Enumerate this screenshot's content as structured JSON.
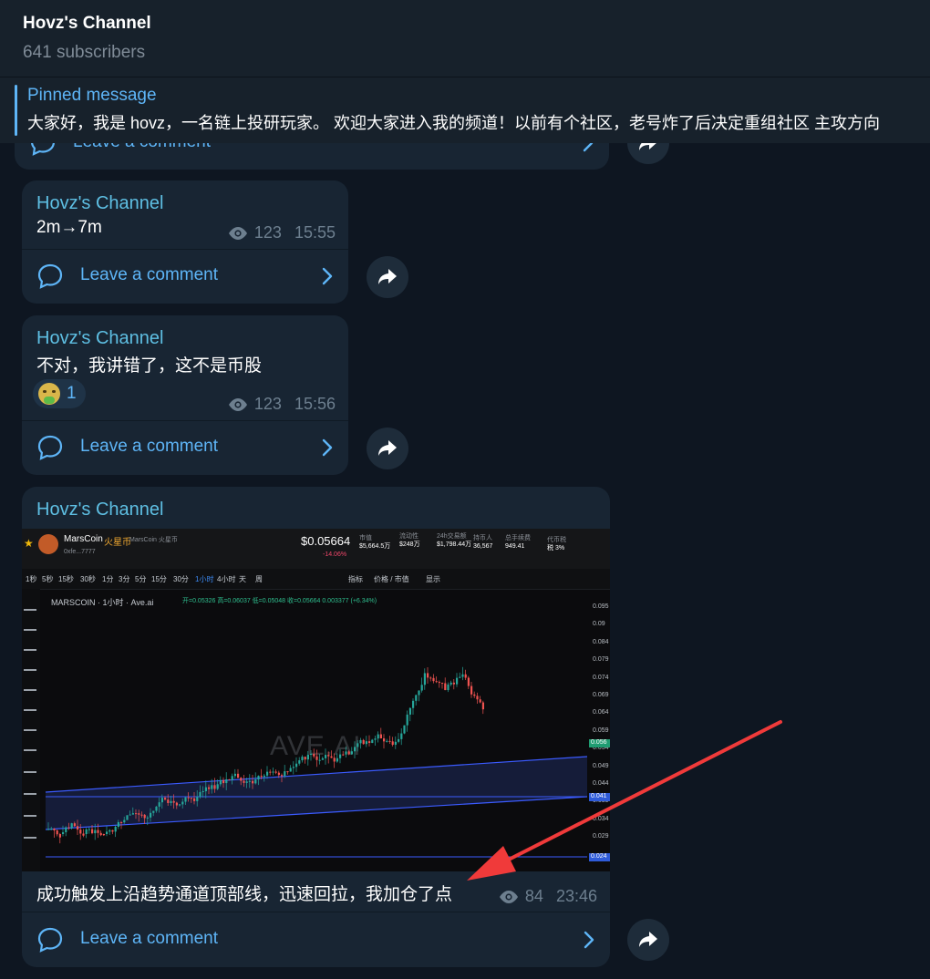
{
  "header": {
    "title": "Hovz's Channel",
    "subscribers": "641 subscribers"
  },
  "pinned": {
    "label": "Pinned message",
    "text": "大家好，我是 hovz，一名链上投研玩家。 欢迎大家进入我的频道！以前有个社区，老号炸了后决定重组社区  主攻方向"
  },
  "comment_label": "Leave a comment",
  "messages": [
    {
      "text": "",
      "views": "",
      "time": ""
    },
    {
      "sender": "Hovz's Channel",
      "text": "2m→7m",
      "views": "123",
      "time": "15:55"
    },
    {
      "sender": "Hovz's Channel",
      "text": "不对，我讲错了，这不是币股",
      "views": "123",
      "time": "15:56",
      "reaction": {
        "emoji": "nauseated-face",
        "count": "1"
      }
    },
    {
      "sender": "Hovz's Channel",
      "text": "成功触发上沿趋势通道顶部线，迅速回拉，我加仓了点",
      "views": "84",
      "time": "23:46"
    }
  ],
  "chart_image": {
    "coin": "MarsCoin",
    "coin_cn": "火星币",
    "coin_sub": "MarsCoin 火星币",
    "address": "0xfe...7777",
    "price": "$0.05664",
    "change": "-14.06%",
    "stats": [
      {
        "label": "市值",
        "value": "$5,664.5万"
      },
      {
        "label": "流动性",
        "value": "$248万"
      },
      {
        "label": "24h交易额",
        "value": "$1,798.44万"
      },
      {
        "label": "持币人",
        "value": "36,567"
      },
      {
        "label": "总手续费",
        "value": "949.41"
      },
      {
        "label": "代币税",
        "value": "税 3%"
      }
    ],
    "timeframes": [
      "1秒",
      "5秒",
      "15秒",
      "30秒",
      "1分",
      "3分",
      "5分",
      "15分",
      "30分",
      "1小时",
      "4小时",
      "天",
      "周"
    ],
    "active_timeframe": "1小时",
    "toolbar_items": [
      "指标",
      "价格 / 市值",
      "显示"
    ],
    "symbol_info": "MARSCOIN · 1小时 · Ave.ai",
    "ohlc": "开=0.05326 高=0.06037 低=0.05048 收=0.05664 0.003377 (+6.34%)",
    "watermark": "AVE.AI",
    "y_ticks": [
      "0.095",
      "0.09",
      "0.084",
      "0.079",
      "0.074",
      "0.069",
      "0.064",
      "0.059",
      "0.054",
      "0.049",
      "0.044",
      "0.039",
      "0.034",
      "0.029"
    ],
    "price_badges": [
      {
        "value": "0.056",
        "color": "#1f9d72"
      },
      {
        "value": "0.041",
        "color": "#2f5bd8"
      },
      {
        "value": "0.024",
        "color": "#2f5bd8"
      }
    ],
    "colors": {
      "up": "#26a69a",
      "down": "#ef5350",
      "channel": "#3b5bff"
    }
  }
}
